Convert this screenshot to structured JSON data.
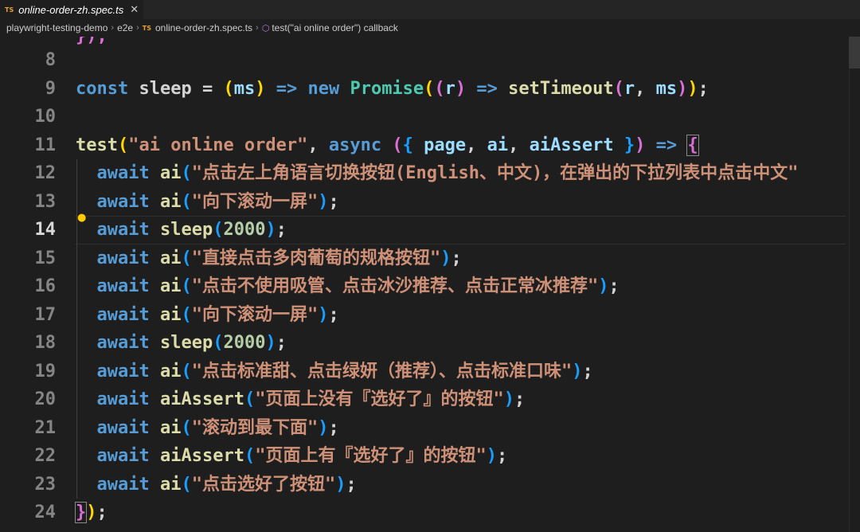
{
  "tab": {
    "badge": "TS",
    "file_name": "online-order-zh.spec.ts",
    "close_glyph": "✕"
  },
  "breadcrumb": {
    "items": [
      "playwright-testing-demo",
      "e2e",
      "online-order-zh.spec.ts",
      "test(\"ai online order\") callback"
    ],
    "file_badge": "TS",
    "fn_icon": "symbol-method-icon"
  },
  "editor": {
    "active_line": 14,
    "bracket_color_1": "#ffd700",
    "bracket_color_2": "#da70d6",
    "bracket_color_3": "#179fff",
    "partial_top_line": "});",
    "lines": [
      {
        "n": "8",
        "tokens": []
      },
      {
        "n": "9",
        "tokens": [
          [
            "kw",
            "const"
          ],
          [
            "var",
            " sleep "
          ],
          [
            "op",
            "= "
          ],
          [
            "b1",
            "("
          ],
          [
            "param",
            "ms"
          ],
          [
            "b1",
            ")"
          ],
          [
            "op",
            " "
          ],
          [
            "arrow",
            "=>"
          ],
          [
            "op",
            " "
          ],
          [
            "kw",
            "new"
          ],
          [
            "op",
            " "
          ],
          [
            "cls",
            "Promise"
          ],
          [
            "b1",
            "("
          ],
          [
            "b2",
            "("
          ],
          [
            "param",
            "r"
          ],
          [
            "b2",
            ")"
          ],
          [
            "op",
            " "
          ],
          [
            "arrow",
            "=>"
          ],
          [
            "op",
            " "
          ],
          [
            "fn",
            "setTimeout"
          ],
          [
            "b2",
            "("
          ],
          [
            "param",
            "r"
          ],
          [
            "op",
            ", "
          ],
          [
            "param",
            "ms"
          ],
          [
            "b2",
            ")"
          ],
          [
            "b1",
            ")"
          ],
          [
            "op",
            ";"
          ]
        ]
      },
      {
        "n": "10",
        "tokens": []
      },
      {
        "n": "11",
        "tokens": [
          [
            "fn",
            "test"
          ],
          [
            "b1",
            "("
          ],
          [
            "str",
            "\"ai online order\""
          ],
          [
            "op",
            ", "
          ],
          [
            "kw",
            "async"
          ],
          [
            "op",
            " "
          ],
          [
            "b2",
            "("
          ],
          [
            "b3",
            "{"
          ],
          [
            "param",
            " page"
          ],
          [
            "op",
            ", "
          ],
          [
            "param",
            "ai"
          ],
          [
            "op",
            ", "
          ],
          [
            "param",
            "aiAssert"
          ],
          [
            "op",
            " "
          ],
          [
            "b3",
            "}"
          ],
          [
            "b2",
            ")"
          ],
          [
            "op",
            " "
          ],
          [
            "arrow",
            "=>"
          ],
          [
            "op",
            " "
          ],
          [
            "b2box",
            "{"
          ]
        ]
      },
      {
        "n": "12",
        "tokens": [
          [
            "op",
            "  "
          ],
          [
            "kw",
            "await"
          ],
          [
            "op",
            " "
          ],
          [
            "fn",
            "ai"
          ],
          [
            "b3",
            "("
          ],
          [
            "str",
            "\"点击左上角语言切换按钮(English、中文)，在弹出的下拉列表中点击中文\""
          ]
        ]
      },
      {
        "n": "13",
        "tokens": [
          [
            "op",
            "  "
          ],
          [
            "kw",
            "await"
          ],
          [
            "op",
            " "
          ],
          [
            "fn",
            "ai"
          ],
          [
            "b3",
            "("
          ],
          [
            "str",
            "\"向下滚动一屏\""
          ],
          [
            "b3",
            ")"
          ],
          [
            "op",
            ";"
          ]
        ]
      },
      {
        "n": "14",
        "tokens": [
          [
            "op",
            "  "
          ],
          [
            "kw",
            "await"
          ],
          [
            "op",
            " "
          ],
          [
            "fn",
            "sleep"
          ],
          [
            "b3",
            "("
          ],
          [
            "num",
            "2000"
          ],
          [
            "b3",
            ")"
          ],
          [
            "op",
            ";"
          ]
        ]
      },
      {
        "n": "15",
        "tokens": [
          [
            "op",
            "  "
          ],
          [
            "kw",
            "await"
          ],
          [
            "op",
            " "
          ],
          [
            "fn",
            "ai"
          ],
          [
            "b3",
            "("
          ],
          [
            "str",
            "\"直接点击多肉葡萄的规格按钮\""
          ],
          [
            "b3",
            ")"
          ],
          [
            "op",
            ";"
          ]
        ]
      },
      {
        "n": "16",
        "tokens": [
          [
            "op",
            "  "
          ],
          [
            "kw",
            "await"
          ],
          [
            "op",
            " "
          ],
          [
            "fn",
            "ai"
          ],
          [
            "b3",
            "("
          ],
          [
            "str",
            "\"点击不使用吸管、点击冰沙推荐、点击正常冰推荐\""
          ],
          [
            "b3",
            ")"
          ],
          [
            "op",
            ";"
          ]
        ]
      },
      {
        "n": "17",
        "tokens": [
          [
            "op",
            "  "
          ],
          [
            "kw",
            "await"
          ],
          [
            "op",
            " "
          ],
          [
            "fn",
            "ai"
          ],
          [
            "b3",
            "("
          ],
          [
            "str",
            "\"向下滚动一屏\""
          ],
          [
            "b3",
            ")"
          ],
          [
            "op",
            ";"
          ]
        ]
      },
      {
        "n": "18",
        "tokens": [
          [
            "op",
            "  "
          ],
          [
            "kw",
            "await"
          ],
          [
            "op",
            " "
          ],
          [
            "fn",
            "sleep"
          ],
          [
            "b3",
            "("
          ],
          [
            "num",
            "2000"
          ],
          [
            "b3",
            ")"
          ],
          [
            "op",
            ";"
          ]
        ]
      },
      {
        "n": "19",
        "tokens": [
          [
            "op",
            "  "
          ],
          [
            "kw",
            "await"
          ],
          [
            "op",
            " "
          ],
          [
            "fn",
            "ai"
          ],
          [
            "b3",
            "("
          ],
          [
            "str",
            "\"点击标准甜、点击绿妍（推荐）、点击标准口味\""
          ],
          [
            "b3",
            ")"
          ],
          [
            "op",
            ";"
          ]
        ]
      },
      {
        "n": "20",
        "tokens": [
          [
            "op",
            "  "
          ],
          [
            "kw",
            "await"
          ],
          [
            "op",
            " "
          ],
          [
            "fn",
            "aiAssert"
          ],
          [
            "b3",
            "("
          ],
          [
            "str",
            "\"页面上没有『选好了』的按钮\""
          ],
          [
            "b3",
            ")"
          ],
          [
            "op",
            ";"
          ]
        ]
      },
      {
        "n": "21",
        "tokens": [
          [
            "op",
            "  "
          ],
          [
            "kw",
            "await"
          ],
          [
            "op",
            " "
          ],
          [
            "fn",
            "ai"
          ],
          [
            "b3",
            "("
          ],
          [
            "str",
            "\"滚动到最下面\""
          ],
          [
            "b3",
            ")"
          ],
          [
            "op",
            ";"
          ]
        ]
      },
      {
        "n": "22",
        "tokens": [
          [
            "op",
            "  "
          ],
          [
            "kw",
            "await"
          ],
          [
            "op",
            " "
          ],
          [
            "fn",
            "aiAssert"
          ],
          [
            "b3",
            "("
          ],
          [
            "str",
            "\"页面上有『选好了』的按钮\""
          ],
          [
            "b3",
            ")"
          ],
          [
            "op",
            ";"
          ]
        ]
      },
      {
        "n": "23",
        "tokens": [
          [
            "op",
            "  "
          ],
          [
            "kw",
            "await"
          ],
          [
            "op",
            " "
          ],
          [
            "fn",
            "ai"
          ],
          [
            "b3",
            "("
          ],
          [
            "str",
            "\"点击选好了按钮\""
          ],
          [
            "b3",
            ")"
          ],
          [
            "op",
            ";"
          ]
        ]
      },
      {
        "n": "24",
        "tokens": [
          [
            "b2box",
            "}"
          ],
          [
            "b1",
            ")"
          ],
          [
            "op",
            ";"
          ]
        ]
      }
    ]
  }
}
